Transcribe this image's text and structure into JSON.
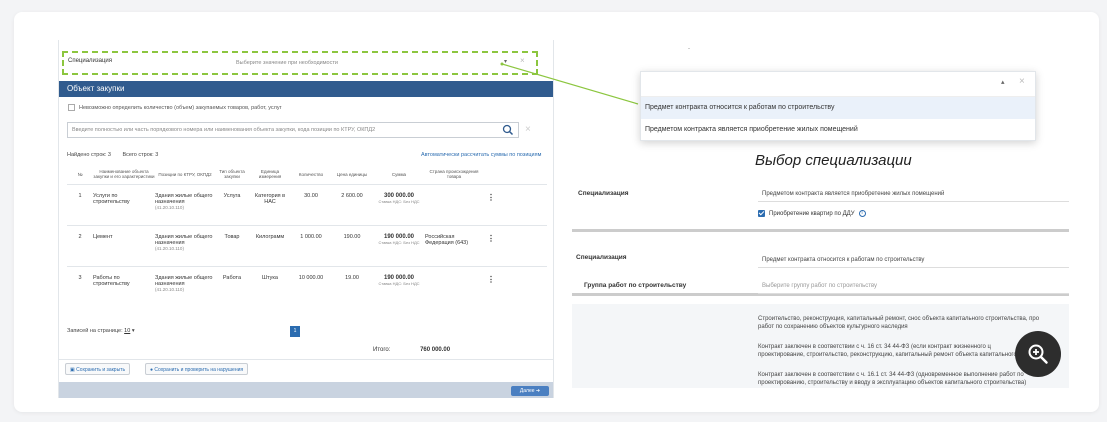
{
  "left": {
    "spec_label": "Специализация",
    "spec_placeholder": "Выберите значение при необходимости",
    "section_title": "Объект закупки",
    "cannot_determine": "Невозможно определить количество (объем) закупаемых товаров, работ, услуг",
    "search_placeholder": "Введите полностью или часть порядкового номера или наименования объекта закупки, кода позиции по КТРУ, ОКПД2",
    "found_rows": "Найдено строк: 3",
    "total_rows": "Всего строк: 3",
    "auto_calc": "Автоматически рассчитать суммы по позициям",
    "headers": [
      "№",
      "Наименование объекта закупки и его характеристики",
      "Позиции по КТРУ, ОКПД2",
      "Тип объекта закупки",
      "Единица измерения",
      "Количество",
      "Цена единицы",
      "Сумма",
      "Страна происхождения товара"
    ],
    "rows": [
      {
        "n": "1",
        "name": "Услуги по строительству",
        "okpd": "Здания жилые общего назначения",
        "code": "(41.20.10.110)",
        "type": "Услуга",
        "unit": "Категория в НАС",
        "qty": "30.00",
        "price": "2 600.00",
        "sum": "300 000.00",
        "vat": "Ставка НДС: Без НДС",
        "country": ""
      },
      {
        "n": "2",
        "name": "Цемент",
        "okpd": "Здания жилые общего назначения",
        "code": "(41.20.10.110)",
        "type": "Товар",
        "unit": "Килограмм",
        "qty": "1 000.00",
        "price": "190.00",
        "sum": "190 000.00",
        "vat": "Ставка НДС: Без НДС",
        "country": "Российская Федерация (643)"
      },
      {
        "n": "3",
        "name": "Работы по строительству",
        "okpd": "Здания жилые общего назначения",
        "code": "(41.20.10.110)",
        "type": "Работа",
        "unit": "Штука",
        "qty": "10 000.00",
        "price": "19.00",
        "sum": "190 000.00",
        "vat": "Ставка НДС: Без НДС",
        "country": ""
      }
    ],
    "per_page_label": "Записей на странице:",
    "per_page_value": "10",
    "page": "1",
    "total_label": "Итого:",
    "total_value": "760 000.00",
    "save_close": "Сохранить и закрыть",
    "save_check": "Сохранить и проверить на нарушения",
    "next": "Далее"
  },
  "dropdown": {
    "options": [
      "Предмет контракта относится к работам по строительству",
      "Предметом контракта является приобретение жилых помещений"
    ]
  },
  "title": "Выбор специализации",
  "form1": {
    "label": "Специализация",
    "value": "Предметом контракта является приобретение жилых помещений",
    "checkbox": "Приобретение квартир по ДДУ"
  },
  "form2": {
    "label": "Специализация",
    "value": "Предмет контракта относится к работам по строительству",
    "group_label": "Группа работ по строительству",
    "group_placeholder": "Выберите группу работ по строительству"
  },
  "info": [
    "Строительство, реконструкция, капитальный ремонт, снос объекта капитального строительства, про",
    "работ по сохранению объектов культурного наследия",
    "Контракт заключен в соответствии с ч. 16 ст. 34 44-ФЗ (если контракт жизненного ц",
    "проектирование, строительство, реконструкцию, капитальный ремонт объекта капитального строите",
    "Контракт заключен в соответствии с ч. 16.1 ст. 34 44-ФЗ (одновременное выполнение работ по",
    "проектированию, строительству и вводу в эксплуатацию объектов капитального строительства)"
  ],
  "colors": {
    "accent": "#305b8e",
    "highlight": "#8cc63f"
  }
}
